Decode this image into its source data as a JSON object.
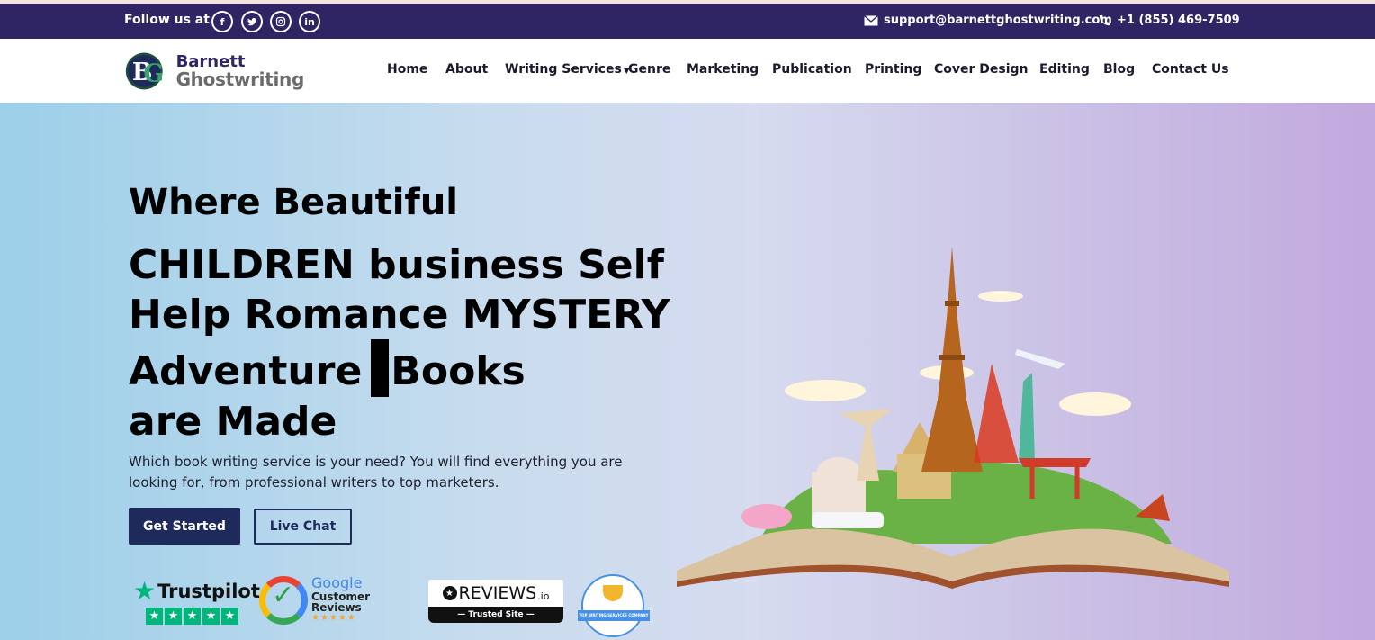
{
  "topbar": {
    "follow_label": "Follow us at",
    "social": [
      "facebook-icon",
      "twitter-icon",
      "instagram-icon",
      "linkedin-icon"
    ],
    "email": "support@barnettghostwriting.com",
    "phone": "+1 (855) 469-7509"
  },
  "logo": {
    "line1": "Barnett",
    "line2": "Ghostwriting"
  },
  "nav": [
    {
      "label": "Home"
    },
    {
      "label": "About"
    },
    {
      "label": "Writing Services",
      "dropdown": true
    },
    {
      "label": "Genre"
    },
    {
      "label": "Marketing"
    },
    {
      "label": "Publication"
    },
    {
      "label": "Printing"
    },
    {
      "label": "Cover Design"
    },
    {
      "label": "Editing"
    },
    {
      "label": "Blog"
    },
    {
      "label": "Contact Us"
    }
  ],
  "hero": {
    "line1": "Where Beautiful",
    "genres_line1": "CHILDREN business Self",
    "genres_line2": "Help Romance MYSTERY",
    "genres_line3": "Adventure",
    "books_word": "Books",
    "line_last": "are Made",
    "subtext": "Which book writing service is your need? You will find everything you are looking for, from professional writers to top marketers.",
    "cta_primary": "Get Started",
    "cta_secondary": "Live Chat"
  },
  "badges": {
    "trustpilot": "Trustpilot",
    "google_word": "Google",
    "google_sub": "Customer Reviews",
    "reviews_word": "REVIEWS",
    "reviews_suffix": ".io",
    "reviews_trusted": "— Trusted Site —",
    "goodfirms": "TOP WRITING SERVICES COMPANY"
  },
  "colors": {
    "topbar_bg": "#2f2464",
    "primary_button": "#1f2a5c",
    "trustpilot_green": "#00b67a"
  }
}
